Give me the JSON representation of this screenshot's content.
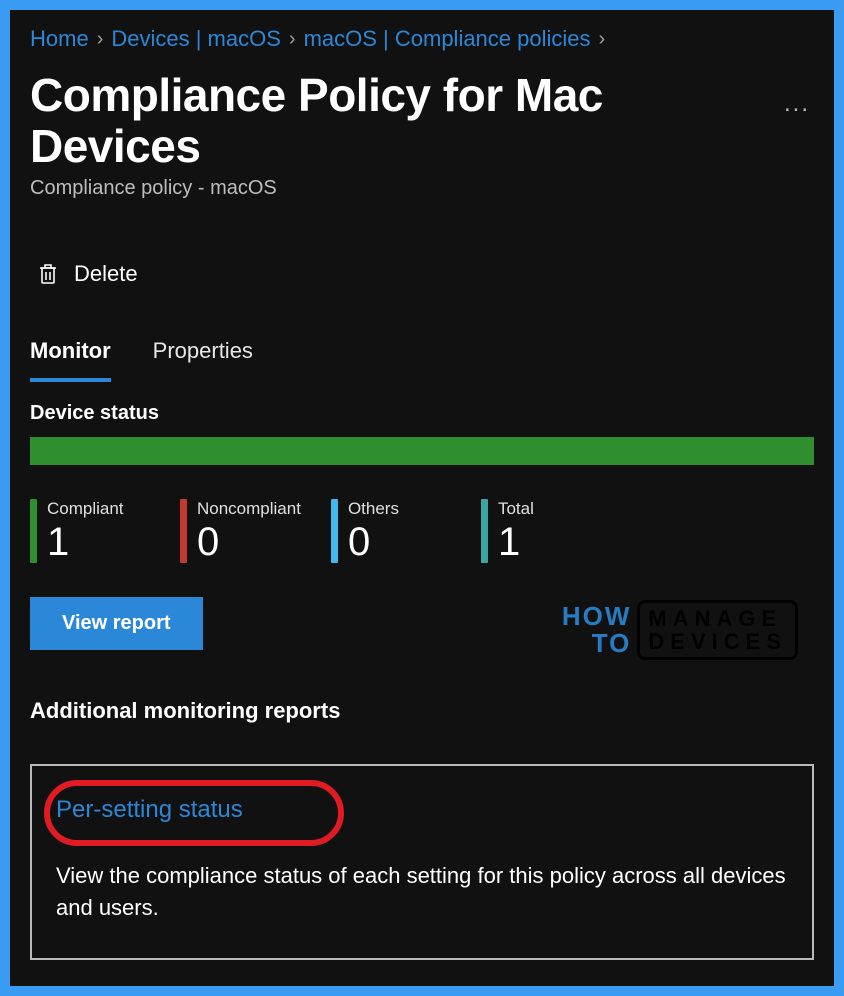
{
  "breadcrumbs": {
    "items": [
      {
        "label": "Home"
      },
      {
        "label": "Devices | macOS"
      },
      {
        "label": "macOS | Compliance policies"
      }
    ],
    "trailing_sep": true
  },
  "header": {
    "title": "Compliance Policy for Mac Devices",
    "subtitle": "Compliance policy - macOS",
    "more_label": "..."
  },
  "toolbar": {
    "delete": {
      "label": "Delete"
    }
  },
  "tabs": [
    {
      "id": "monitor",
      "label": "Monitor",
      "active": true
    },
    {
      "id": "properties",
      "label": "Properties",
      "active": false
    }
  ],
  "device_status": {
    "heading": "Device status",
    "bar_color": "#2f8f2f",
    "stats": [
      {
        "label": "Compliant",
        "value": "1",
        "color": "#2f8f2f"
      },
      {
        "label": "Noncompliant",
        "value": "0",
        "color": "#c0392b"
      },
      {
        "label": "Others",
        "value": "0",
        "color": "#3fb9f0"
      },
      {
        "label": "Total",
        "value": "1",
        "color": "#3aa6a3"
      }
    ],
    "view_report_label": "View report"
  },
  "watermark": {
    "left_line1": "HOW",
    "left_line2": "TO",
    "right_line1": "MANAGE",
    "right_line2": "DEVICES"
  },
  "reports": {
    "heading": "Additional monitoring reports",
    "card": {
      "link_label": "Per-setting status",
      "description": "View the compliance status of each setting for this policy across all devices and users."
    }
  }
}
